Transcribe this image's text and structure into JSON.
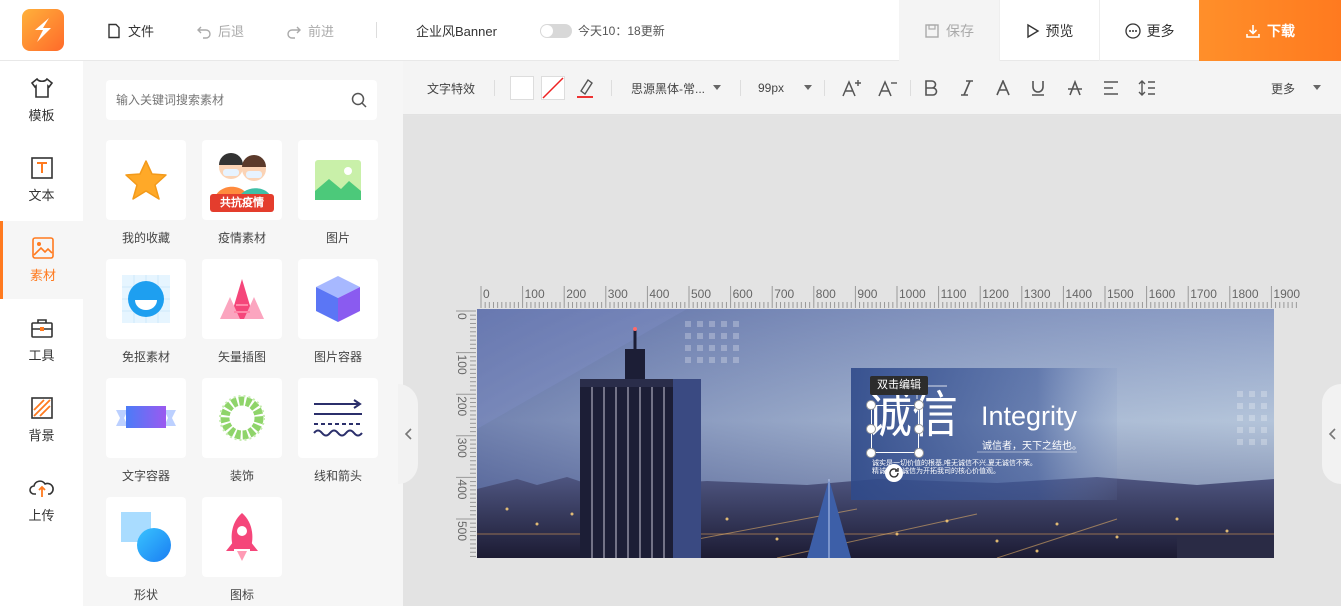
{
  "topbar": {
    "file": "文件",
    "undo": "后退",
    "redo": "前进",
    "doc_title": "企业风Banner",
    "autosave": "今天10：18更新",
    "save": "保存",
    "preview": "预览",
    "more": "更多",
    "download": "下载"
  },
  "nav": [
    {
      "label": "模板",
      "icon": "shirt-icon"
    },
    {
      "label": "文本",
      "icon": "text-icon"
    },
    {
      "label": "素材",
      "icon": "image-icon"
    },
    {
      "label": "工具",
      "icon": "toolbox-icon"
    },
    {
      "label": "背景",
      "icon": "stripes-icon"
    },
    {
      "label": "上传",
      "icon": "cloud-upload-icon"
    }
  ],
  "panel": {
    "search_placeholder": "输入关键词搜索素材",
    "tiles": [
      {
        "label": "我的收藏",
        "icon": "star-icon"
      },
      {
        "label": "疫情素材",
        "icon": "epidemic-icon",
        "badge": "共抗疫情"
      },
      {
        "label": "图片",
        "icon": "picture-icon"
      },
      {
        "label": "免抠素材",
        "icon": "smile-icon"
      },
      {
        "label": "矢量插图",
        "icon": "tree-icon"
      },
      {
        "label": "图片容器",
        "icon": "cube-icon"
      },
      {
        "label": "文字容器",
        "icon": "ribbon-icon"
      },
      {
        "label": "装饰",
        "icon": "wreath-icon"
      },
      {
        "label": "线和箭头",
        "icon": "arrow-lines-icon"
      },
      {
        "label": "形状",
        "icon": "shapes-icon"
      },
      {
        "label": "图标",
        "icon": "rocket-icon"
      }
    ]
  },
  "toolbar": {
    "text_effect": "文字特效",
    "font": "思源黑体-常...",
    "size": "99px",
    "more": "更多"
  },
  "ruler": {
    "h": [
      "0",
      "100",
      "200",
      "300",
      "400",
      "500",
      "600",
      "700",
      "800",
      "900",
      "1000",
      "1100",
      "1200",
      "1300",
      "1400",
      "1500",
      "1600",
      "1700",
      "1800",
      "1900"
    ],
    "v": [
      "0",
      "100",
      "200",
      "300",
      "400",
      "500"
    ]
  },
  "banner": {
    "edit_hint": "双击编辑",
    "title_cn": "诚信",
    "title_en": "Integrity",
    "subtitle": "诚信者，天下之结也。",
    "body_line1": "诚实是一切价值的根基,唯无诚信不兴,夏无诚信不荣。",
    "body_line2": "精诚团结,诚信为开拓我司的核心价值观。"
  },
  "colors": {
    "accent": "#ff7a1f"
  }
}
